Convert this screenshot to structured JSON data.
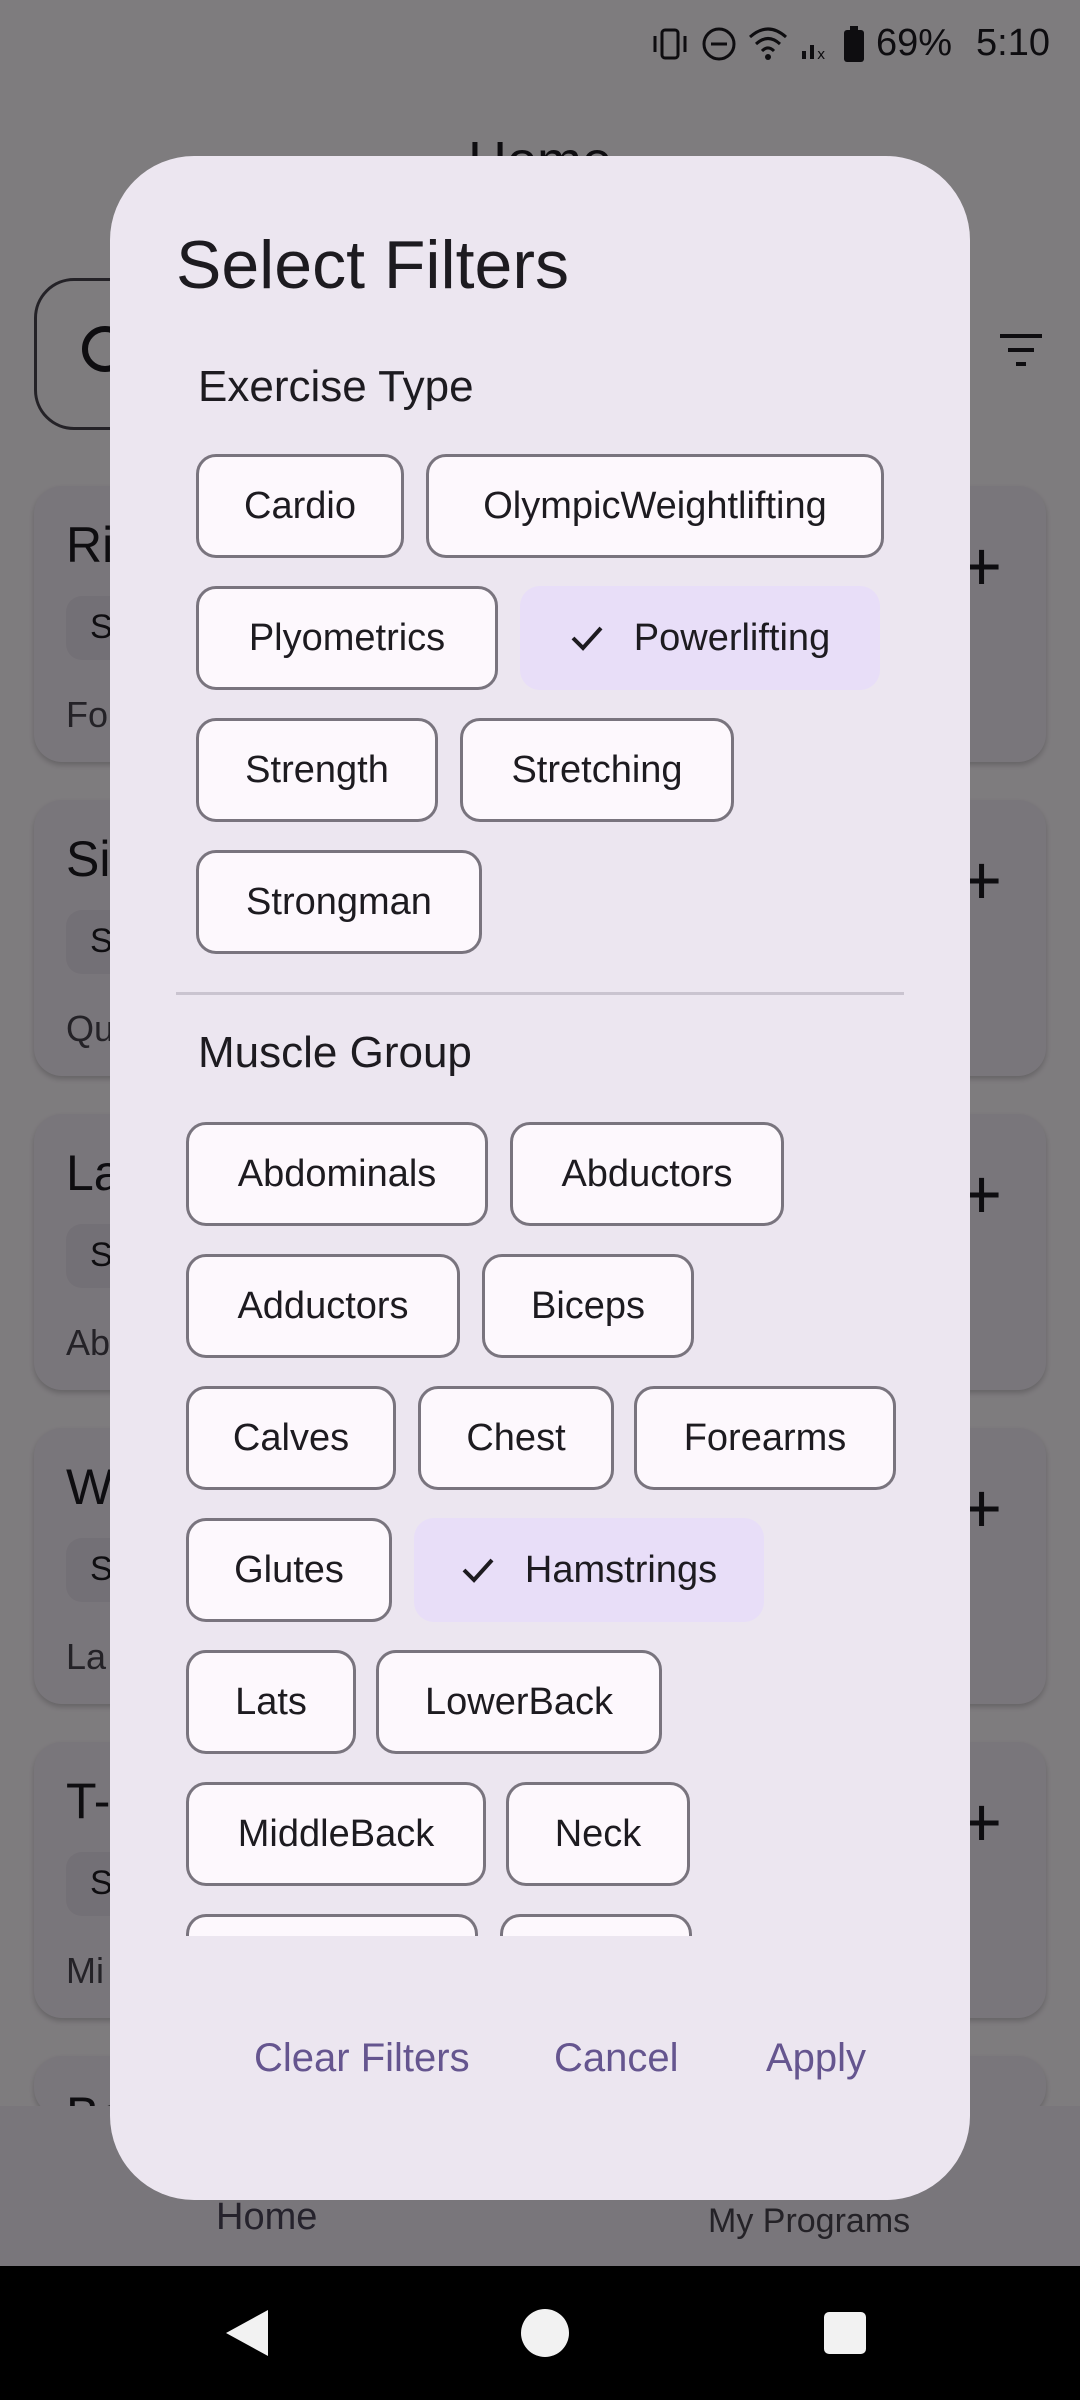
{
  "status": {
    "battery": "69%",
    "time": "5:10"
  },
  "app": {
    "title": "Home",
    "cards": [
      {
        "name": "Ri",
        "chip": "S",
        "sub": "Fo"
      },
      {
        "name": "Si",
        "chip": "S",
        "sub": "Qu"
      },
      {
        "name": "La",
        "chip": "S",
        "sub": "Ab"
      },
      {
        "name": "W",
        "chip": "S",
        "sub": "La"
      },
      {
        "name": "T-I",
        "chip": "S",
        "sub": "Mi"
      },
      {
        "name": "Ba",
        "chip": "",
        "sub": ""
      }
    ],
    "card_add": "+",
    "nav": {
      "home": "Home",
      "programs": "My Programs"
    }
  },
  "dialog": {
    "title": "Select Filters",
    "exercise_type": {
      "label": "Exercise Type",
      "options": [
        {
          "label": "Cardio",
          "selected": false
        },
        {
          "label": "OlympicWeightlifting",
          "selected": false
        },
        {
          "label": "Plyometrics",
          "selected": false
        },
        {
          "label": "Powerlifting",
          "selected": true
        },
        {
          "label": "Strength",
          "selected": false
        },
        {
          "label": "Stretching",
          "selected": false
        },
        {
          "label": "Strongman",
          "selected": false
        }
      ]
    },
    "muscle_group": {
      "label": "Muscle Group",
      "options": [
        {
          "label": "Abdominals",
          "selected": false
        },
        {
          "label": "Abductors",
          "selected": false
        },
        {
          "label": "Adductors",
          "selected": false
        },
        {
          "label": "Biceps",
          "selected": false
        },
        {
          "label": "Calves",
          "selected": false
        },
        {
          "label": "Chest",
          "selected": false
        },
        {
          "label": "Forearms",
          "selected": false
        },
        {
          "label": "Glutes",
          "selected": false
        },
        {
          "label": "Hamstrings",
          "selected": true
        },
        {
          "label": "Lats",
          "selected": false
        },
        {
          "label": "LowerBack",
          "selected": false
        },
        {
          "label": "MiddleBack",
          "selected": false
        },
        {
          "label": "Neck",
          "selected": false
        }
      ]
    },
    "actions": {
      "clear": "Clear Filters",
      "cancel": "Cancel",
      "apply": "Apply"
    }
  },
  "colors": {
    "accent": "#65558f",
    "selected_chip": "#e8def8",
    "dialog_bg": "#ece6f0"
  }
}
